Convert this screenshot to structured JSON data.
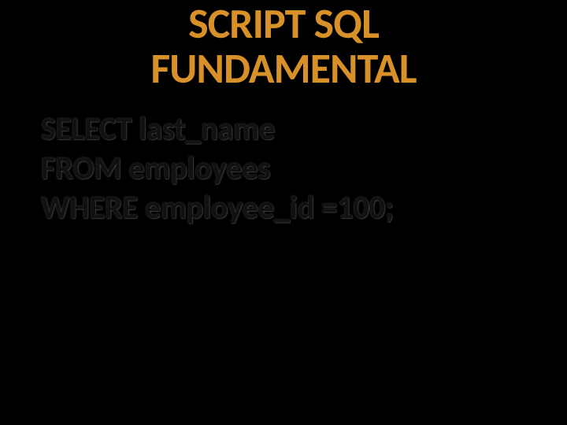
{
  "title": {
    "line1": "SCRIPT SQL",
    "line2": "FUNDAMENTAL"
  },
  "code": {
    "line1": "SELECT  last_name",
    "line2": "FROM employees",
    "line3": "WHERE employee_id =100;"
  }
}
